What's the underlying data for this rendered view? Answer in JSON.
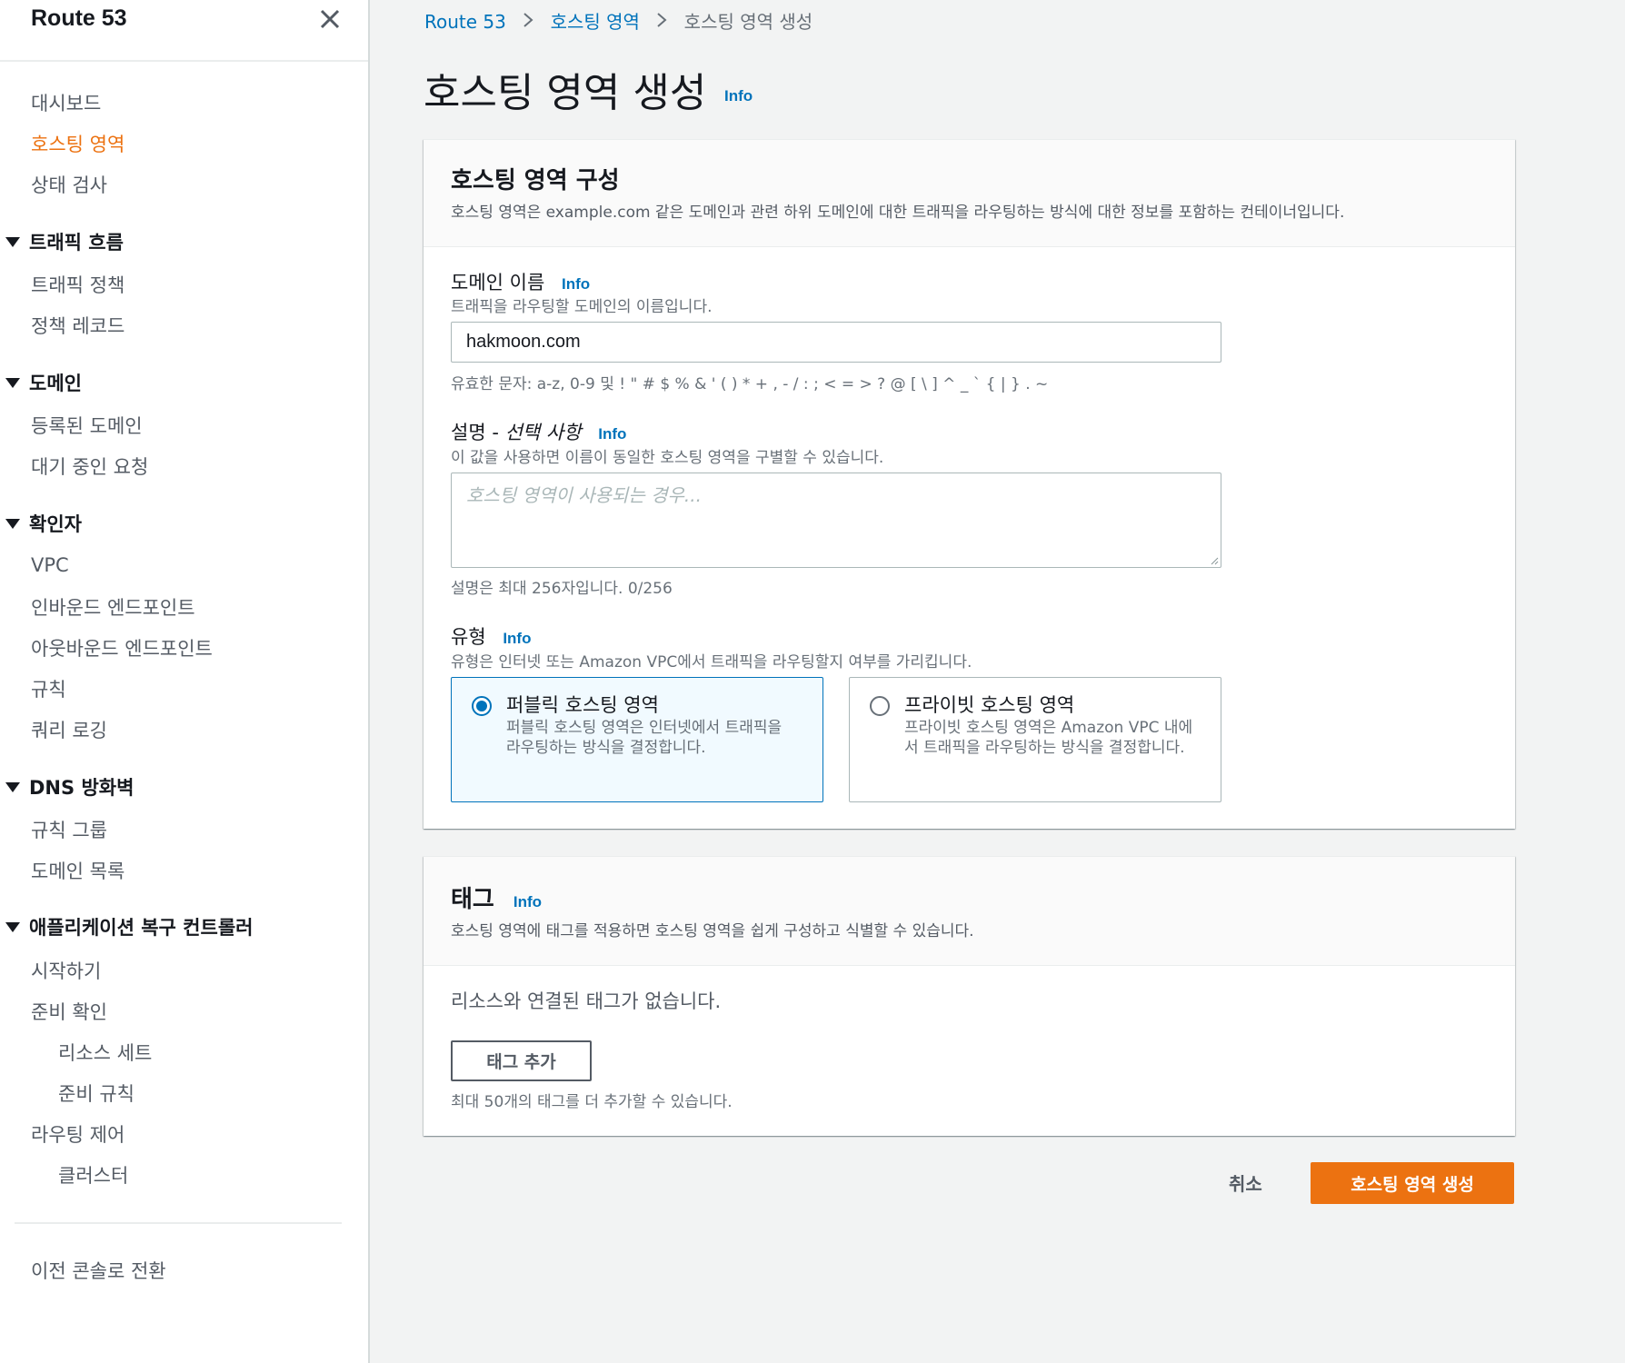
{
  "sidebar": {
    "title": "Route 53",
    "items": {
      "dashboard": "대시보드",
      "hosted_zones": "호스팅 영역",
      "health_checks": "상태 검사",
      "traffic_flow": "트래픽 흐름",
      "traffic_policies": "트래픽 정책",
      "policy_records": "정책 레코드",
      "domains": "도메인",
      "registered_domains": "등록된 도메인",
      "pending_requests": "대기 중인 요청",
      "resolver": "확인자",
      "vpc": "VPC",
      "inbound_endpoints": "인바운드 엔드포인트",
      "outbound_endpoints": "아웃바운드 엔드포인트",
      "rules": "규칙",
      "query_logging": "쿼리 로깅",
      "dns_firewall": "DNS 방화벽",
      "rule_groups": "규칙 그룹",
      "domain_lists": "도메인 목록",
      "arc": "애플리케이션 복구 컨트롤러",
      "getting_started": "시작하기",
      "readiness_check": "준비 확인",
      "resource_sets": "리소스 세트",
      "readiness_rules": "준비 규칙",
      "routing_control": "라우팅 제어",
      "clusters": "클러스터",
      "switch_console": "이전 콘솔로 전환"
    }
  },
  "breadcrumb": {
    "root": "Route 53",
    "parent": "호스팅 영역",
    "current": "호스팅 영역 생성"
  },
  "page": {
    "title": "호스팅 영역 생성",
    "info": "Info"
  },
  "config": {
    "title": "호스팅 영역 구성",
    "description": "호스팅 영역은 example.com 같은 도메인과 관련 하위 도메인에 대한 트래픽을 라우팅하는 방식에 대한 정보를 포함하는 컨테이너입니다.",
    "domain": {
      "label": "도메인 이름",
      "info": "Info",
      "description": "트래픽을 라우팅할 도메인의 이름입니다.",
      "value": "hakmoon.com",
      "constraint": "유효한 문자: a-z, 0-9 및 ! \" # $ % & ' ( ) * + , - / : ; < = > ? @ [ \\ ] ^ _ ` { | } . ~"
    },
    "description_field": {
      "label_main": "설명 - ",
      "label_optional": "선택 사항",
      "info": "Info",
      "description": "이 값을 사용하면 이름이 동일한 호스팅 영역을 구별할 수 있습니다.",
      "placeholder": "호스팅 영역이 사용되는 경우...",
      "constraint": "설명은 최대 256자입니다. 0/256"
    },
    "type": {
      "label": "유형",
      "info": "Info",
      "description": "유형은 인터넷 또는 Amazon VPC에서 트래픽을 라우팅할지 여부를 가리킵니다.",
      "public_title": "퍼블릭 호스팅 영역",
      "public_desc": "퍼블릭 호스팅 영역은 인터넷에서 트래픽을 라우팅하는 방식을 결정합니다.",
      "private_title": "프라이빗 호스팅 영역",
      "private_desc": "프라이빗 호스팅 영역은 Amazon VPC 내에서 트래픽을 라우팅하는 방식을 결정합니다."
    }
  },
  "tags": {
    "title": "태그",
    "info": "Info",
    "description": "호스팅 영역에 태그를 적용하면 호스팅 영역을 쉽게 구성하고 식별할 수 있습니다.",
    "empty": "리소스와 연결된 태그가 없습니다.",
    "add_button": "태그 추가",
    "limit": "최대 50개의 태그를 더 추가할 수 있습니다."
  },
  "footer": {
    "cancel": "취소",
    "submit": "호스팅 영역 생성"
  },
  "colors": {
    "accent": "#ec7211",
    "link": "#0073bb"
  }
}
